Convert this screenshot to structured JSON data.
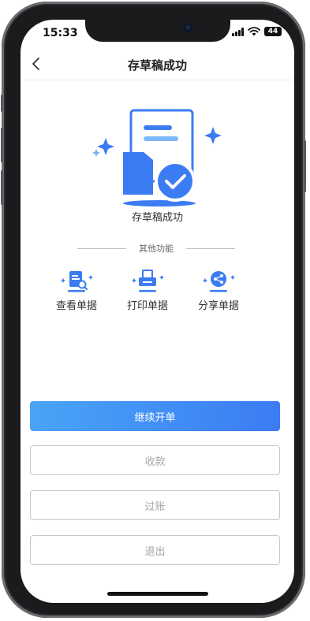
{
  "status_bar": {
    "time": "15:33",
    "battery": "44"
  },
  "nav": {
    "title": "存草稿成功"
  },
  "hero": {
    "message": "存草稿成功"
  },
  "other_functions": {
    "title": "其他功能",
    "items": [
      {
        "label": "查看单据",
        "icon": "view-document-icon"
      },
      {
        "label": "打印单据",
        "icon": "print-icon"
      },
      {
        "label": "分享单据",
        "icon": "share-icon"
      }
    ]
  },
  "actions": {
    "continue": "继续开单",
    "collect": "收款",
    "post": "过账",
    "exit": "退出"
  },
  "colors": {
    "accent": "#3b7cf3",
    "accent_light": "#4aa4f6"
  }
}
